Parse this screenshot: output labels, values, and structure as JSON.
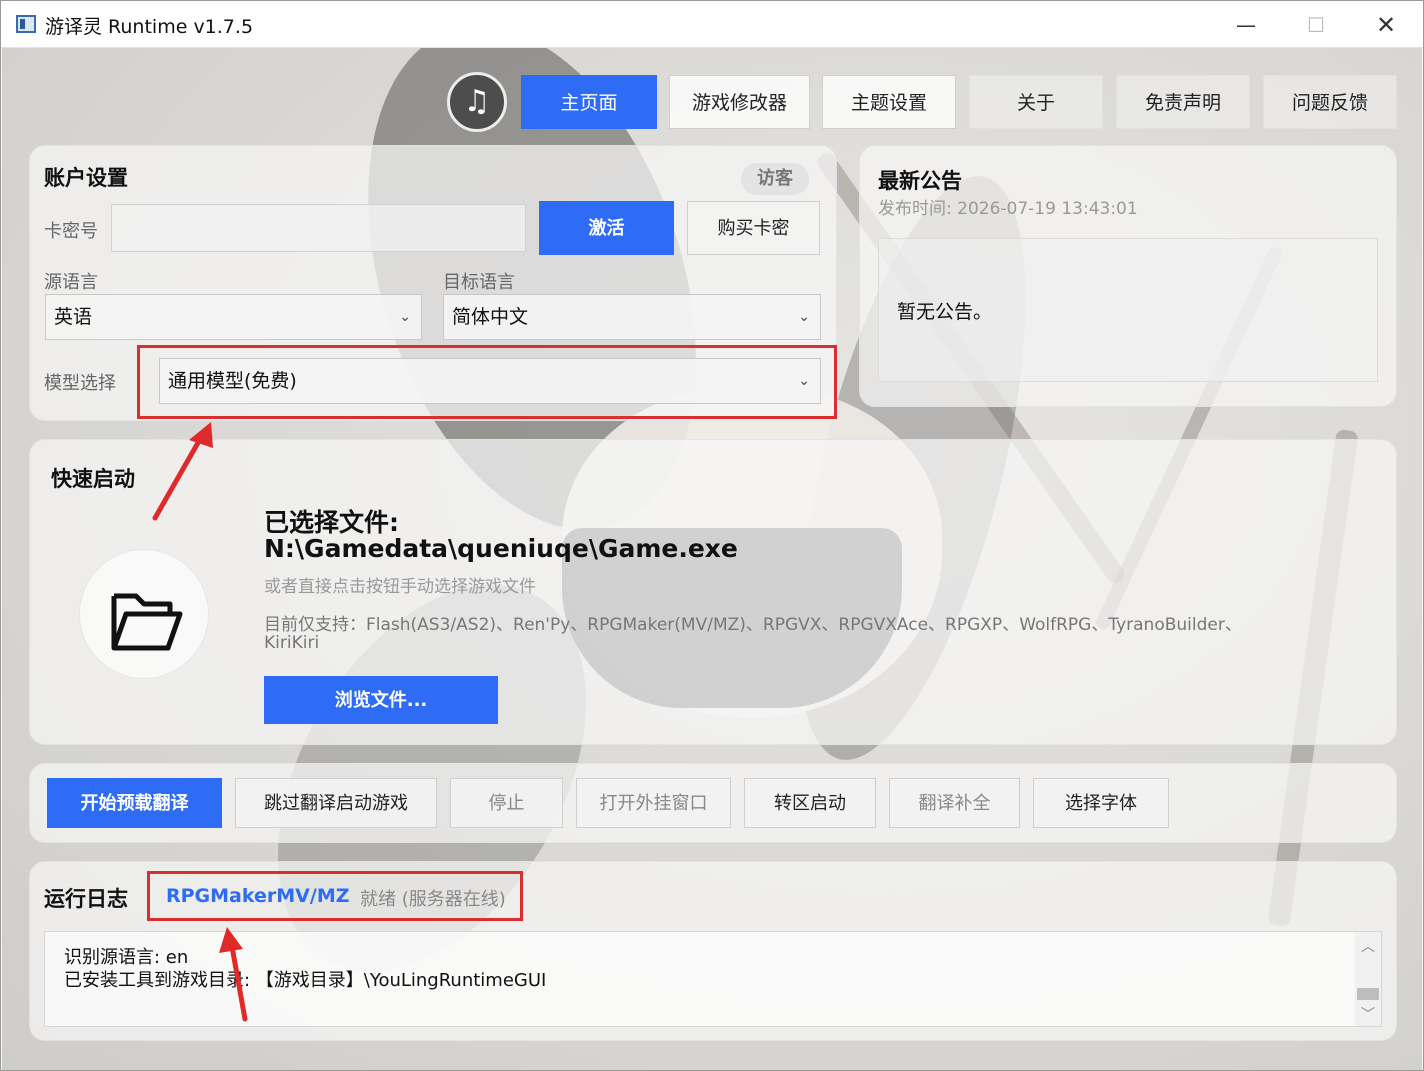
{
  "window": {
    "title": "游译灵 Runtime v1.7.5"
  },
  "nav": {
    "music_icon": "music-note-icon",
    "tabs": [
      "主页面",
      "游戏修改器",
      "主题设置",
      "关于",
      "免责声明",
      "问题反馈"
    ]
  },
  "account": {
    "title": "账户设置",
    "guest_badge": "访客",
    "card_label": "卡密号",
    "card_value": "",
    "activate": "激活",
    "buy": "购买卡密",
    "source_label": "源语言",
    "source_value": "英语",
    "target_label": "目标语言",
    "target_value": "简体中文",
    "model_label": "模型选择",
    "model_value": "通用模型(免费)"
  },
  "announcement": {
    "title": "最新公告",
    "published": "发布时间: 2026-07-19 13:43:01",
    "body": "暂无公告。"
  },
  "quick": {
    "title": "快速启动",
    "selected_label": "已选择文件:",
    "selected_path": "N:\\Gamedata\\queniuqe\\Game.exe",
    "hint": "或者直接点击按钮手动选择游戏文件",
    "support": "目前仅支持：Flash(AS3/AS2)、Ren'Py、RPGMaker(MV/MZ)、RPGVX、RPGVXAce、RPGXP、WolfRPG、TyranoBuilder、",
    "support_cont": "KiriKiri",
    "browse": "浏览文件..."
  },
  "actions": [
    "开始预载翻译",
    "跳过翻译启动游戏",
    "停止",
    "打开外挂窗口",
    "转区启动",
    "翻译补全",
    "选择字体"
  ],
  "log": {
    "title": "运行日志",
    "engine": "RPGMakerMV/MZ",
    "status": "就绪 (服务器在线)",
    "lines": [
      "识别源语言: en",
      "已安装工具到游戏目录: 【游戏目录】\\YouLingRuntimeGUI"
    ]
  },
  "colors": {
    "accent": "#2e6cf6",
    "highlight": "#d83030"
  }
}
